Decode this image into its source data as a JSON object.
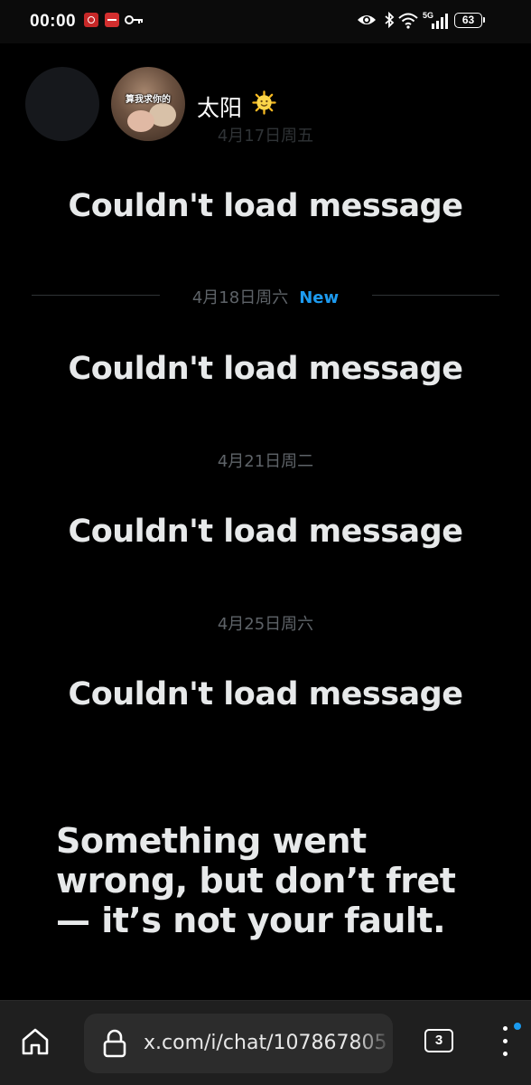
{
  "status_bar": {
    "time": "00:00",
    "network": "5G",
    "battery": "63"
  },
  "header": {
    "contact_name": "太阳",
    "avatar_caption": "算我求你的"
  },
  "thread": {
    "items": [
      {
        "date": "4月17日周五",
        "message": "Couldn't load message"
      },
      {
        "date": "4月18日周六",
        "new_badge": "New",
        "message": "Couldn't load message"
      },
      {
        "date": "4月21日周二",
        "message": "Couldn't load message"
      },
      {
        "date": "4月25日周六",
        "message": "Couldn't load message"
      }
    ],
    "error": "Something went wrong, but don’t fret — it’s not your fault."
  },
  "browser": {
    "url": "x.com/i/chat/107867805",
    "tab_count": "3"
  },
  "colors": {
    "background": "#000000",
    "accent": "#1d9bf0",
    "text": "#e7e9ea",
    "muted": "#5e6368"
  },
  "icons": [
    "alarm-notification-icon",
    "app-notification-icon",
    "key-icon",
    "eye-icon",
    "bluetooth-icon",
    "wifi-icon",
    "signal-icon",
    "battery-icon",
    "sun-emoji-icon",
    "home-icon",
    "lock-icon",
    "tabs-icon",
    "menu-icon"
  ]
}
